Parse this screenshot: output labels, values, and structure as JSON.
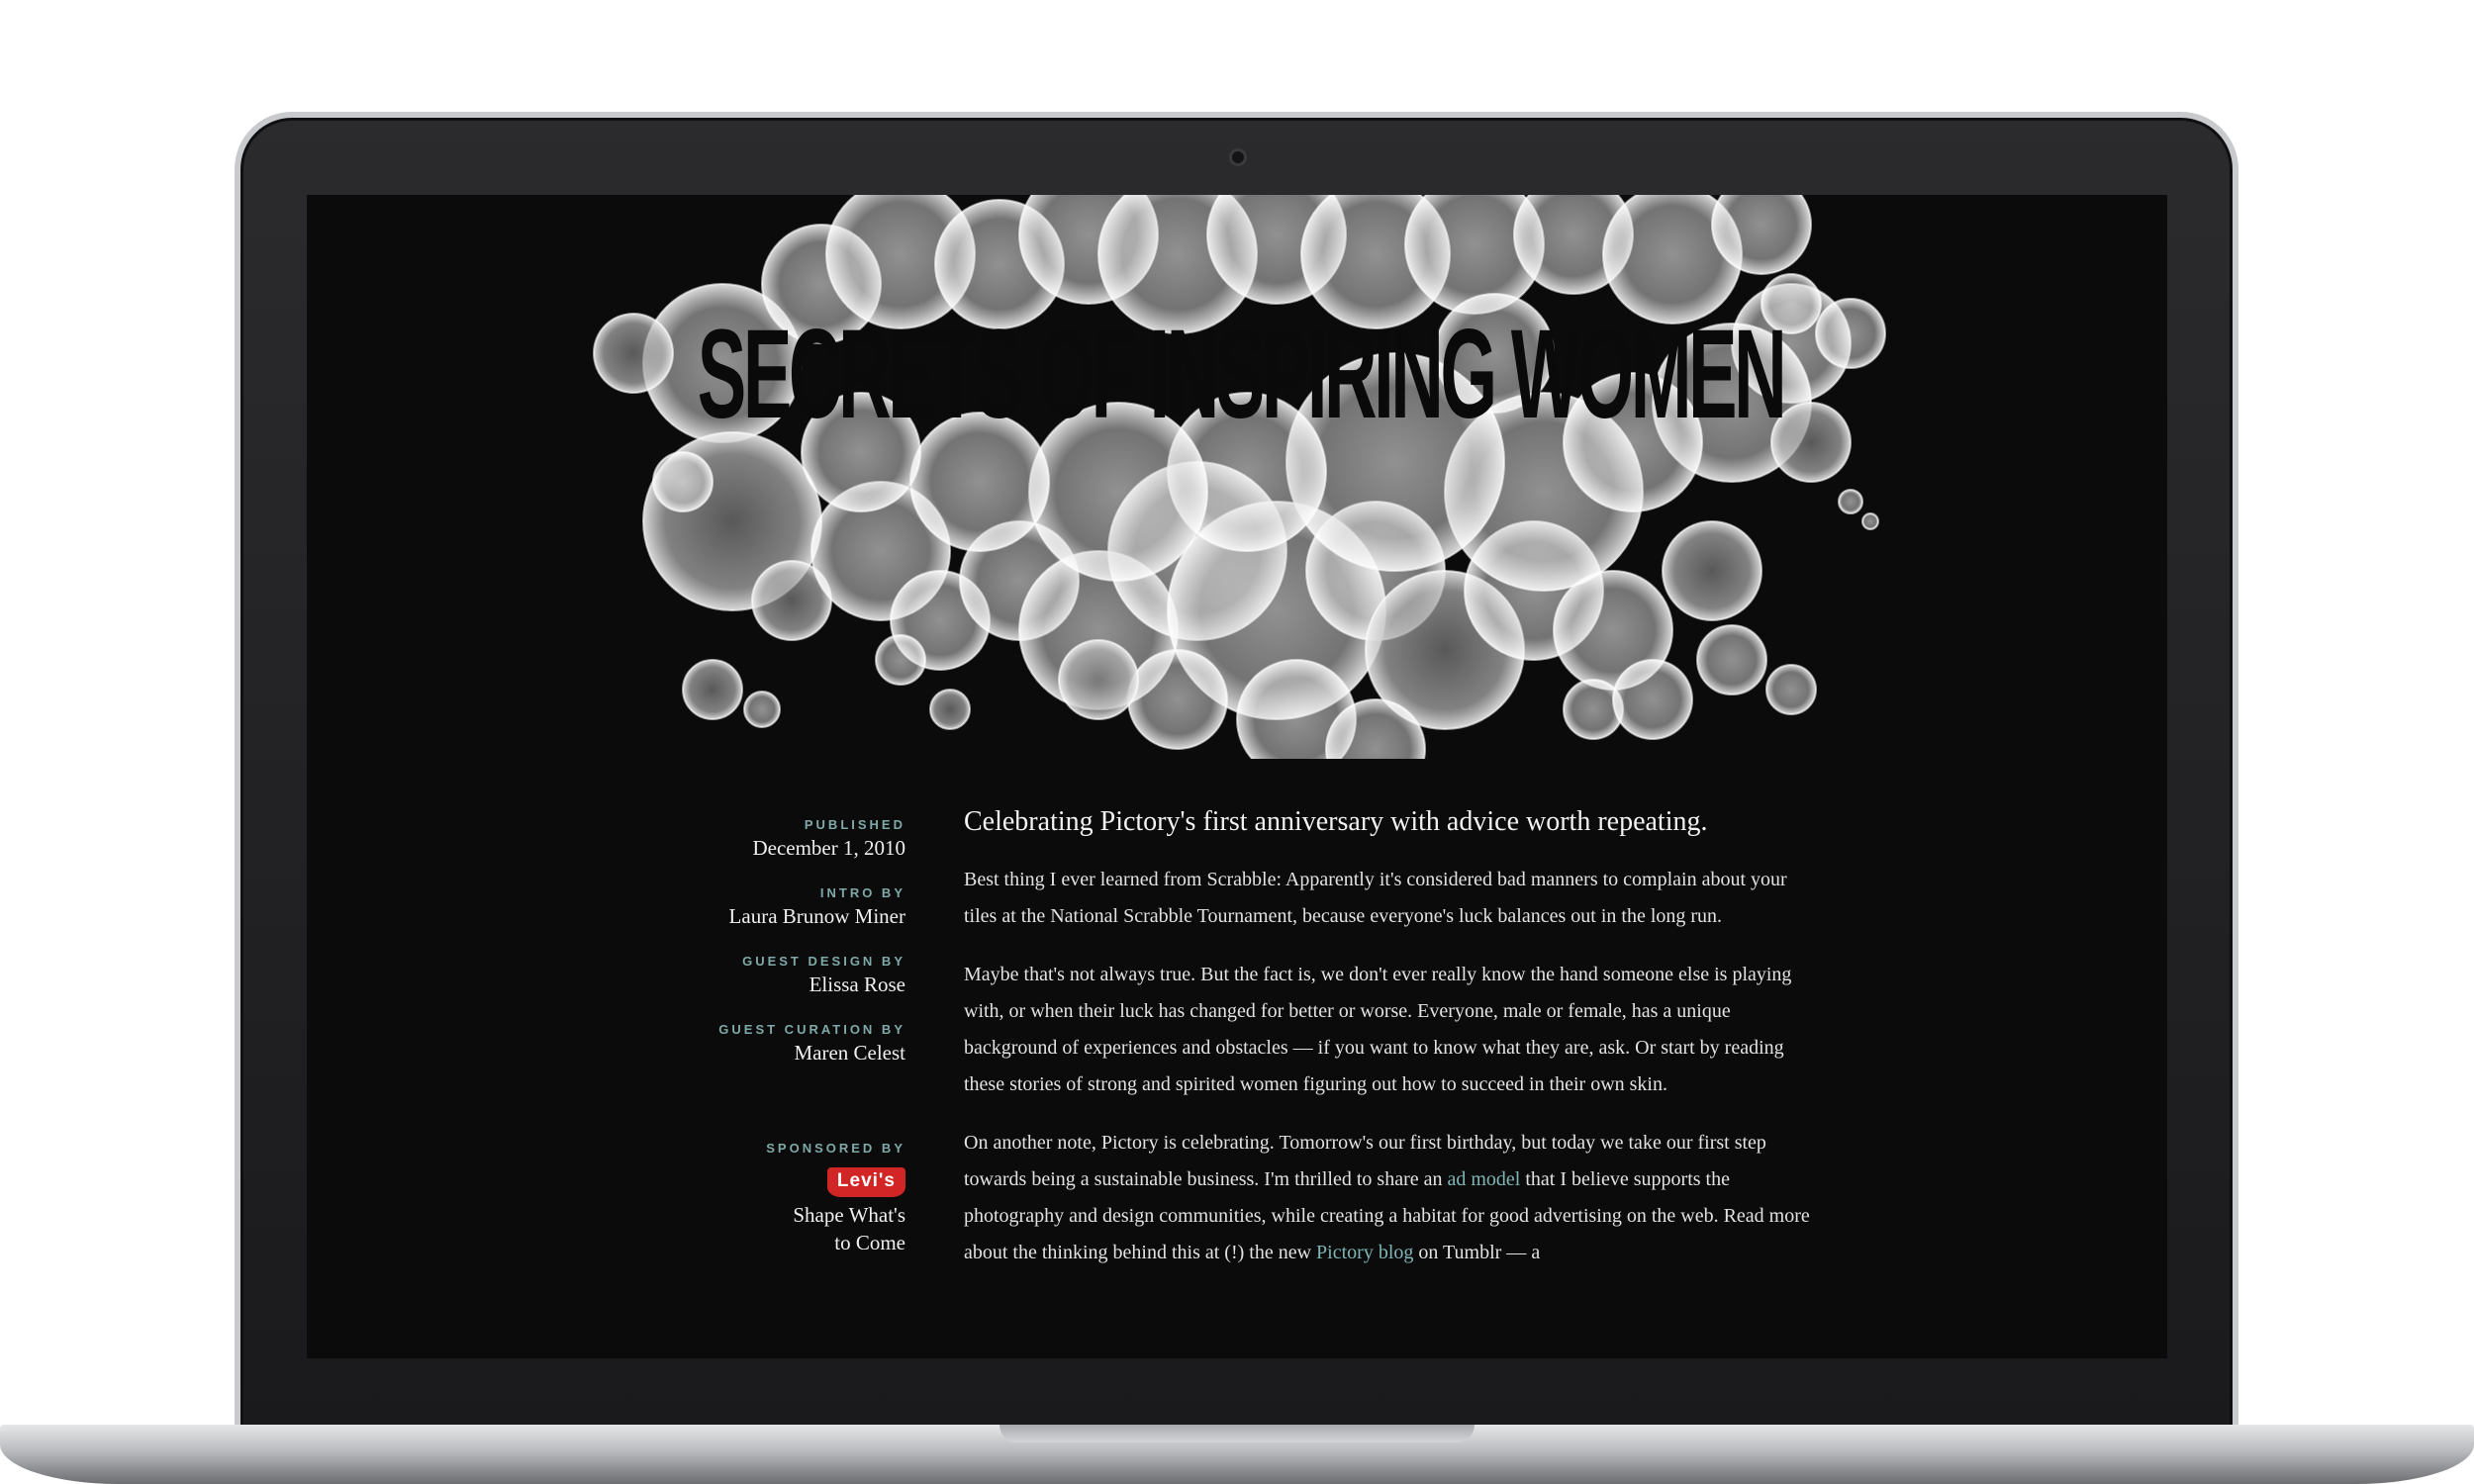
{
  "hero": {
    "title": "SECRETS OF INSPIRING WOMEN"
  },
  "meta": {
    "published_label": "PUBLISHED",
    "published_value": "December 1, 2010",
    "intro_label": "INTRO BY",
    "intro_value": "Laura Brunow Miner",
    "design_label": "GUEST DESIGN BY",
    "design_value": "Elissa Rose",
    "curation_label": "GUEST CURATION BY",
    "curation_value": "Maren Celest",
    "sponsor_label": "SPONSORED BY",
    "sponsor_logo": "Levi's",
    "sponsor_tagline_1": "Shape What's",
    "sponsor_tagline_2": "to Come"
  },
  "article": {
    "heading": "Celebrating Pictory's first anniversary with advice worth repeating.",
    "p1": "Best thing I ever learned from Scrabble: Apparently it's considered bad manners to complain about your tiles at the National Scrabble Tournament, because everyone's luck balances out in the long run.",
    "p2": "Maybe that's not always true. But the fact is, we don't ever really know the hand someone else is playing with, or when their luck has changed for better or worse. Everyone, male or female, has a unique background of experiences and obstacles — if you want to know what they are, ask. Or start by reading these stories of strong and spirited women figuring out how to succeed in their own skin.",
    "p3_a": "On another note, Pictory is celebrating. Tomorrow's our first birthday, but today we take our first step towards being a sustainable business. I'm thrilled to share an ",
    "p3_link1": "ad model",
    "p3_b": " that I believe supports the photography and design communities, while creating a habitat for good advertising on the web. Read more about the thinking behind this at (!) the new ",
    "p3_link2": "Pictory blog",
    "p3_c": " on Tumblr — a"
  },
  "colors": {
    "screen_bg": "#0b0b0c",
    "accent_label": "#7fa9a8",
    "link": "#7fb6b5",
    "levis_red": "#d22626"
  }
}
